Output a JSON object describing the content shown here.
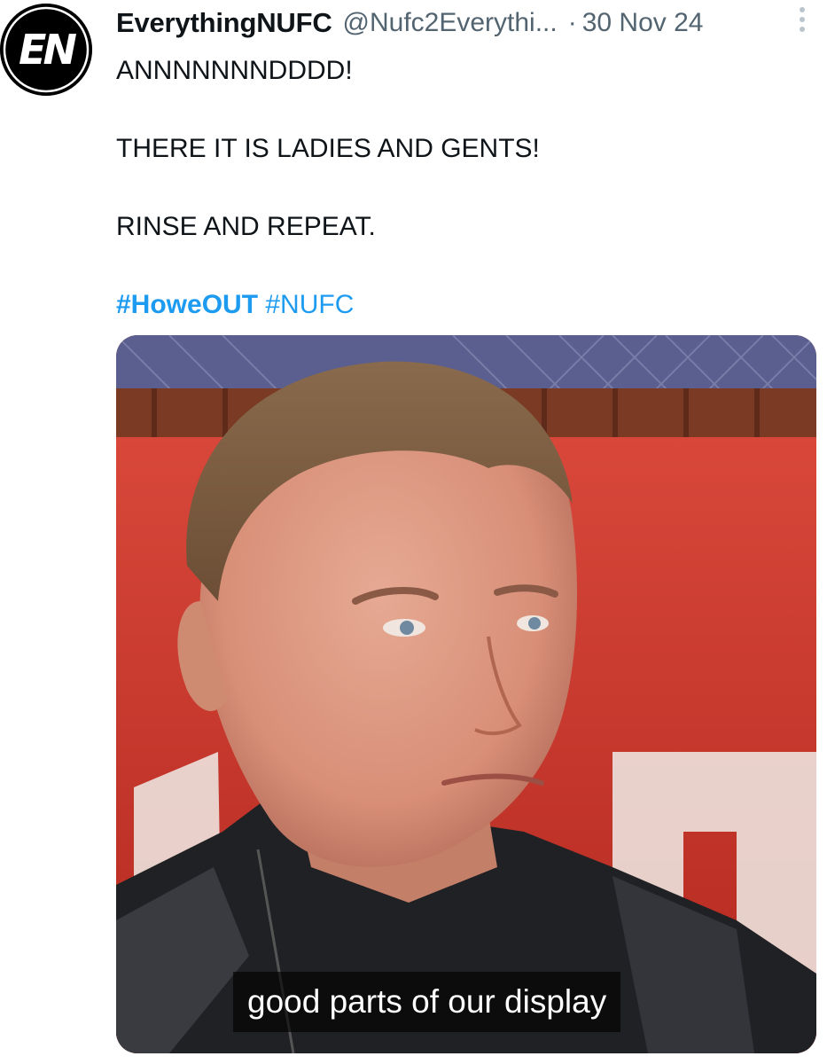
{
  "author": {
    "display_name": "EverythingNUFC",
    "handle": "@Nufc2Everythi...",
    "separator": "·",
    "date": "30 Nov 24",
    "avatar_text": "EN"
  },
  "post": {
    "lines": [
      "ANNNNNNNDDDD!",
      "THERE IT IS LADIES AND GENTS!",
      "RINSE AND REPEAT."
    ],
    "hashtags": [
      "#HoweOUT",
      "#NUFC"
    ]
  },
  "media": {
    "caption": "good parts of our display"
  },
  "icons": {
    "more": "more-vertical-icon"
  },
  "colors": {
    "hashtag": "#1d9bf0",
    "secondary_text": "#536471",
    "primary_text": "#0f1419"
  }
}
